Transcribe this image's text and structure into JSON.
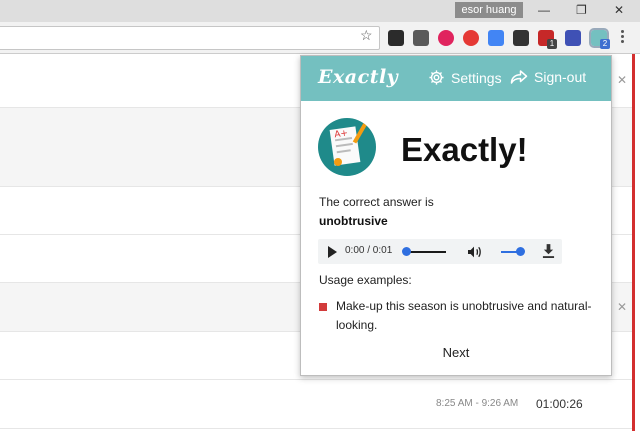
{
  "browser": {
    "profile_name": "esor huang",
    "extension_badges": [
      "1",
      "2"
    ]
  },
  "page": {
    "row_time_range": "8:25 AM - 9:26 AM",
    "row_duration": "01:00:26"
  },
  "popup": {
    "logo": "Exactly",
    "settings_label": "Settings",
    "signout_label": "Sign-out",
    "headline": "Exactly!",
    "answer_label": "The correct answer is",
    "answer_word": "unobtrusive",
    "audio": {
      "time_display": "0:00 / 0:01",
      "progress": 0.0,
      "volume": 1.0
    },
    "usage_label": "Usage examples:",
    "examples": [
      "Make-up this season is unobtrusive and natural-looking."
    ],
    "next_label": "Next"
  },
  "colors": {
    "header_teal": "#74c0c0",
    "accent_blue": "#2f6fe0",
    "bullet_red": "#d23b3b"
  }
}
